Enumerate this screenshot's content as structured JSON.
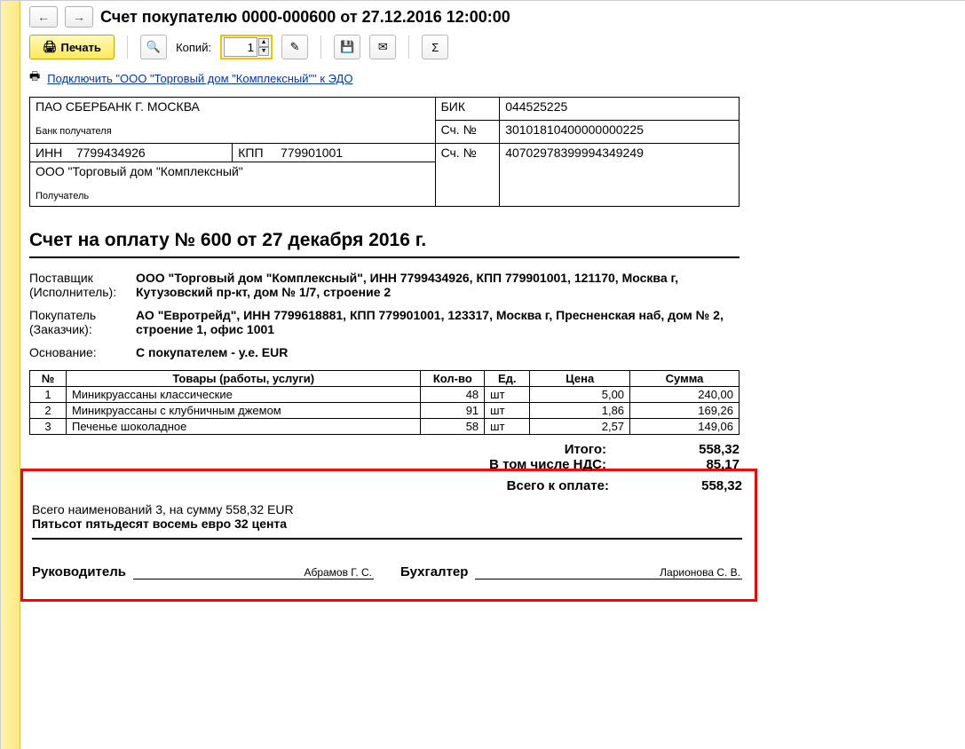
{
  "header": {
    "title": "Счет покупателю 0000-000600 от 27.12.2016 12:00:00"
  },
  "toolbar": {
    "print": "Печать",
    "copies_label": "Копий:",
    "copies_value": "1"
  },
  "edo": {
    "link": "Подключить \"ООО \"Торговый дом \"Комплексный\"\" к ЭДО"
  },
  "bank": {
    "bank_name": "ПАО СБЕРБАНК Г. МОСКВА",
    "bank_recipient_caption": "Банк получателя",
    "bik_label": "БИК",
    "bik": "044525225",
    "corr_label": "Сч. №",
    "corr": "30101810400000000225",
    "inn_label": "ИНН",
    "inn": "7799434926",
    "kpp_label": "КПП",
    "kpp": "779901001",
    "acc_label": "Сч. №",
    "acc": "40702978399994349249",
    "recipient_name": "ООО \"Торговый дом \"Комплексный\"",
    "recipient_caption": "Получатель"
  },
  "doc_title": "Счет на оплату № 600 от 27 декабря 2016 г.",
  "supplier": {
    "label": "Поставщик\n(Исполнитель):",
    "label1": "Поставщик",
    "label2": "(Исполнитель):",
    "text": "ООО \"Торговый дом \"Комплексный\", ИНН 7799434926, КПП 779901001, 121170, Москва г, Кутузовский пр-кт, дом № 1/7, строение 2"
  },
  "buyer": {
    "label1": "Покупатель",
    "label2": "(Заказчик):",
    "text": "АО \"Евротрейд\", ИНН 7799618881, КПП 779901001, 123317, Москва г, Пресненская наб, дом № 2, строение 1, офис 1001"
  },
  "basis": {
    "label": "Основание:",
    "text": "С покупателем - у.е. EUR"
  },
  "items_header": {
    "num": "№",
    "name": "Товары (работы, услуги)",
    "qty": "Кол-во",
    "unit": "Ед.",
    "price": "Цена",
    "sum": "Сумма"
  },
  "items": [
    {
      "num": "1",
      "name": "Миникруассаны классические",
      "qty": "48",
      "unit": "шт",
      "price": "5,00",
      "sum": "240,00"
    },
    {
      "num": "2",
      "name": "Миникруассаны с клубничным джемом",
      "qty": "91",
      "unit": "шт",
      "price": "1,86",
      "sum": "169,26"
    },
    {
      "num": "3",
      "name": "Печенье шоколадное",
      "qty": "58",
      "unit": "шт",
      "price": "2,57",
      "sum": "149,06"
    }
  ],
  "totals": {
    "itogo_label": "Итого:",
    "itogo": "558,32",
    "nds_label": "В том числе НДС:",
    "nds": "85,17",
    "total_label": "Всего к оплате:",
    "total": "558,32"
  },
  "summary": {
    "line1": "Всего наименований 3, на сумму 558,32 EUR",
    "line2": "Пятьсот пятьдесят восемь евро 32 цента"
  },
  "sign": {
    "head_label": "Руководитель",
    "head_name": "Абрамов Г. С.",
    "acc_label": "Бухгалтер",
    "acc_name": "Ларионова С. В."
  }
}
